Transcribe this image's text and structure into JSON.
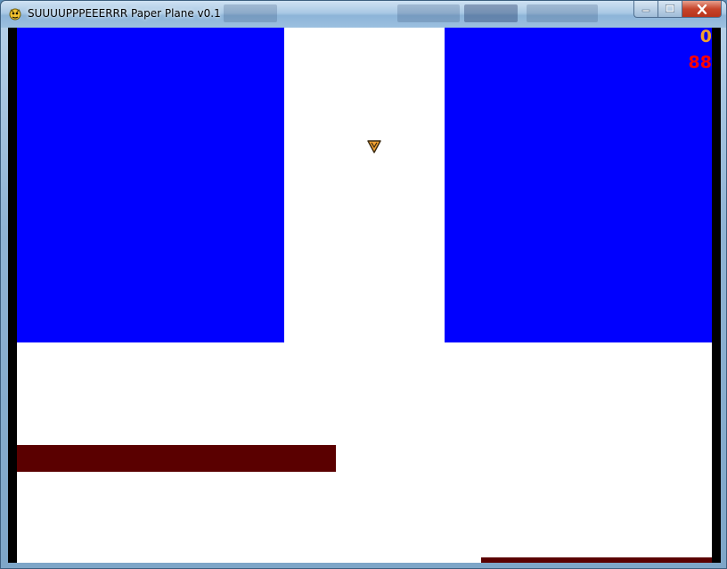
{
  "window": {
    "title": "SUUUUPPPEEERRR Paper Plane v0.1",
    "icon": "pygame-snake-icon",
    "controls": {
      "minimize_icon": "minimize-icon",
      "maximize_icon": "maximize-icon",
      "close_icon": "close-icon"
    }
  },
  "game": {
    "background_color": "#ffffff",
    "border_color": "#000000",
    "hud": {
      "score": "0",
      "score_color": "#f0a030",
      "secondary_counter": "88",
      "secondary_counter_color": "#ff0000"
    },
    "player": {
      "sprite": "paper-plane-icon",
      "color": "#f0a030"
    },
    "obstacles": {
      "wall_color": "#0000ff",
      "bar_color": "#5a0000"
    }
  }
}
